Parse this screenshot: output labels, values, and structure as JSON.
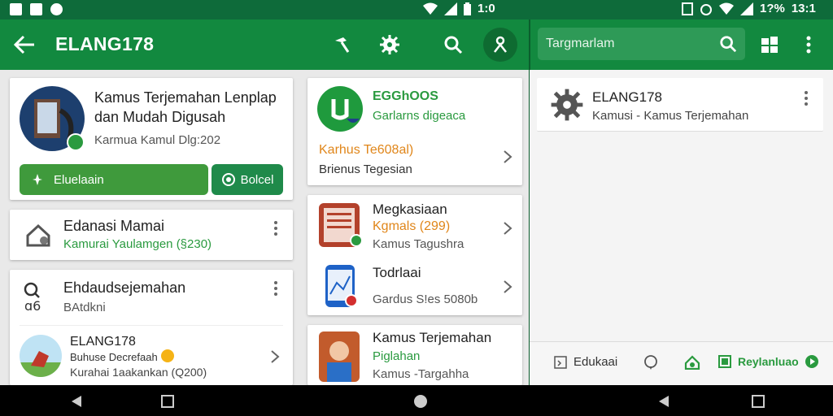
{
  "status_bar": {
    "left_time": "1:0",
    "right_battery": "1?%",
    "right_time": "13:1"
  },
  "appbar": {
    "title": "ELANG178",
    "search_placeholder": "Targmarlam"
  },
  "hero_card": {
    "title_line1": "Kamus Terjemahan Lenplap",
    "title_line2": "dan Mudah Digusah",
    "subtitle": "Karmua Kamul Dlg:202",
    "install_label": "Eluelaain",
    "share_label": "Bolcel"
  },
  "list_card_1": {
    "title": "Edanasi Mamai",
    "subtitle": "Kamurai Yaulamgen (§230)"
  },
  "list_card_2": {
    "title": "Ehdaudsejemahan",
    "subtitle": "BAtdkni",
    "item_title": "ELANG178",
    "item_line2": "Buhuse Decrefaah",
    "item_line3": "Kurahai 1aakankan (Q200)"
  },
  "mid_card_1": {
    "title": "EGGhOOS",
    "subtitle": "Garlarns digeaca",
    "orange_text": "Karhus Te608al)",
    "bottom_text": "Brienus Tegesian"
  },
  "mid_card_2": {
    "item1_title": "Megkasiaan",
    "item1_orange": "Kgmals (299)",
    "item1_sub": "Kamus Tagushra",
    "item2_title": "Todrlaai",
    "item2_sub": "Gardus S!es 5080b"
  },
  "mid_card_3": {
    "title": "Kamus Terjemahan",
    "green": "Piglahan",
    "sub": "Kamus -Targahha"
  },
  "detail": {
    "title": "ELANG178",
    "subtitle": "Kamusi - Kamus Terjemahan"
  },
  "detail_bottom": {
    "item1": "Edukaai",
    "item4": "Reylanluao"
  },
  "colors": {
    "appbar": "#12893f",
    "statusbar": "#0e6b3a",
    "accent_green": "#2a9a3f",
    "orange": "#e0861a"
  }
}
